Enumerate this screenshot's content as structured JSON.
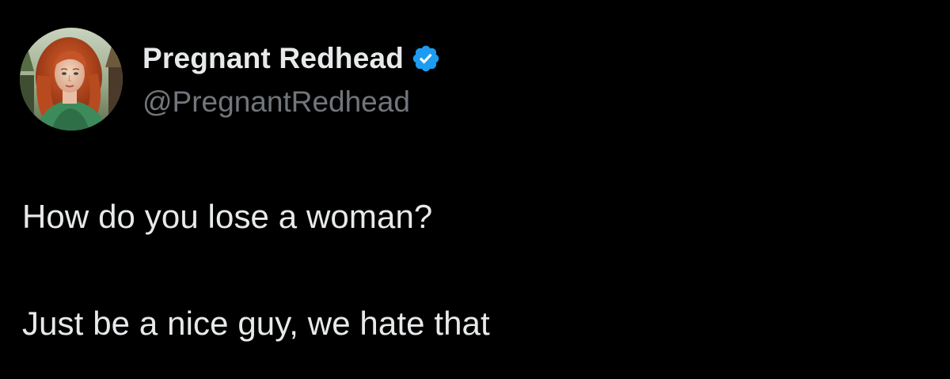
{
  "tweet": {
    "author": {
      "display_name": "Pregnant Redhead",
      "handle": "@PregnantRedhead",
      "verified_icon": "verified-badge-icon",
      "verified_color": "#1d9bf0"
    },
    "text_lines": [
      "How do you lose a woman?",
      "Just be a nice guy, we hate that"
    ]
  },
  "colors": {
    "background": "#000000",
    "primary_text": "#e7e9ea",
    "secondary_text": "#71767b"
  }
}
